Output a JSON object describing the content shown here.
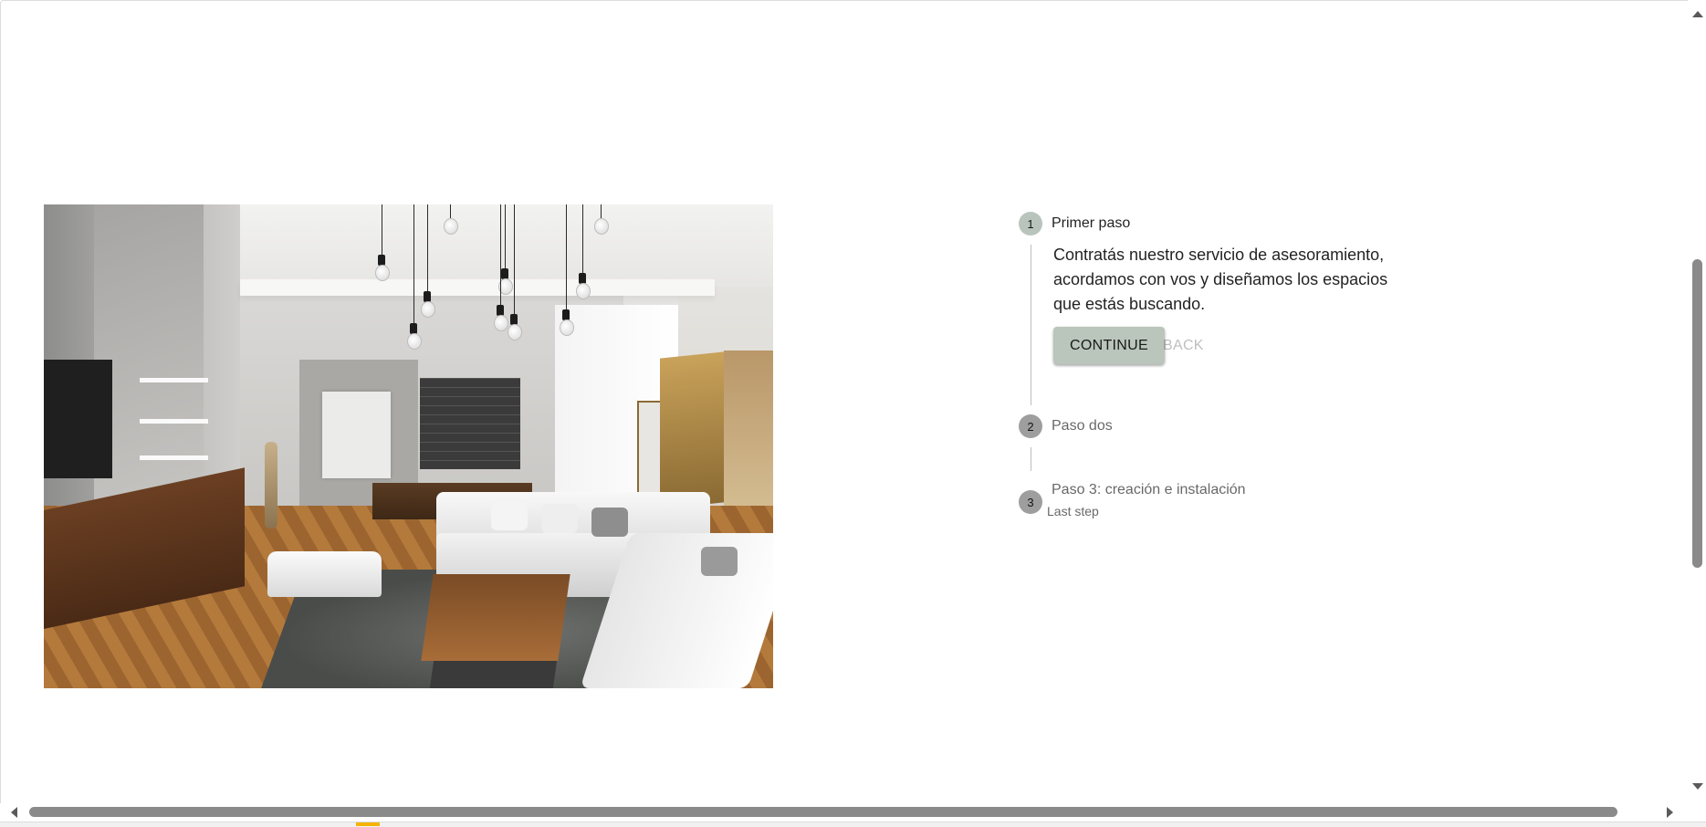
{
  "hero": {
    "alt": "Living room interior"
  },
  "stepper": {
    "steps": [
      {
        "number": "1",
        "title": "Primer paso",
        "content": "Contratás nuestro servicio de asesoramiento, acordamos con vos y diseñamos los espacios que estás buscando.",
        "continue_label": "CONTINUE",
        "back_label": "BACK"
      },
      {
        "number": "2",
        "title": "Paso dos"
      },
      {
        "number": "3",
        "title": "Paso 3: creación e instalación",
        "caption": "Last step"
      }
    ],
    "active_color": "#bac5bc",
    "inactive_color": "#9e9e9e"
  },
  "scrollbars": {
    "up_icon": "arrow-up-icon",
    "down_icon": "arrow-down-icon",
    "left_icon": "arrow-left-icon",
    "right_icon": "arrow-right-icon"
  }
}
